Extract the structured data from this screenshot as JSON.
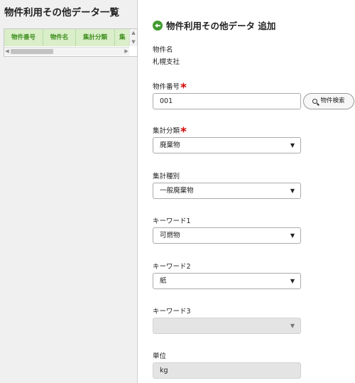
{
  "list": {
    "title": "物件利用その他データ一覧",
    "columns": [
      "物件番号",
      "物件名",
      "集計分類",
      "集"
    ]
  },
  "form": {
    "title": "物件利用その他データ 追加",
    "property_name_label": "物件名",
    "property_name_value": "札幌支社",
    "property_no_label": "物件番号",
    "property_no_value": "001",
    "search_button": "物件検索",
    "category_label": "集計分類",
    "category_value": "廃棄物",
    "type_label": "集計種別",
    "type_value": "一般廃棄物",
    "keyword1_label": "キーワード1",
    "keyword1_value": "可燃物",
    "keyword2_label": "キーワード2",
    "keyword2_value": "紙",
    "keyword3_label": "キーワード3",
    "keyword3_value": "",
    "unit_label": "単位",
    "unit_value": "kg",
    "required_mark": "*"
  },
  "colors": {
    "accent": "#3f9b2e",
    "grid_header_bg": "#d9eec9",
    "required": "#d00000"
  },
  "icons": {
    "back": "arrow-left-circle-icon",
    "search": "search-icon",
    "dropdown": "caret-down-icon"
  }
}
